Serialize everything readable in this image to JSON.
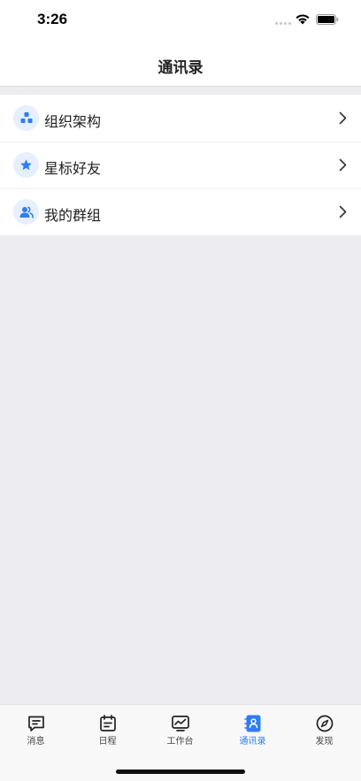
{
  "status": {
    "time": "3:26",
    "icons": [
      "signal-icon",
      "wifi-icon",
      "battery-icon"
    ]
  },
  "nav": {
    "title": "通讯录"
  },
  "menu": {
    "items": [
      {
        "label": "组织架构",
        "icon": "org-structure-icon"
      },
      {
        "label": "星标好友",
        "icon": "star-icon"
      },
      {
        "label": "我的群组",
        "icon": "group-icon"
      }
    ],
    "chevron_icon": "chevron-right-icon"
  },
  "tabs": [
    {
      "label": "消息",
      "icon": "message-icon",
      "active": false
    },
    {
      "label": "日程",
      "icon": "calendar-icon",
      "active": false
    },
    {
      "label": "工作台",
      "icon": "workbench-icon",
      "active": false
    },
    {
      "label": "通讯录",
      "icon": "contacts-icon",
      "active": true
    },
    {
      "label": "发现",
      "icon": "compass-icon",
      "active": false
    }
  ],
  "colors": {
    "accent": "#2e7cf6",
    "icon_bg": "#e6effd",
    "page_bg": "#ededf1"
  }
}
